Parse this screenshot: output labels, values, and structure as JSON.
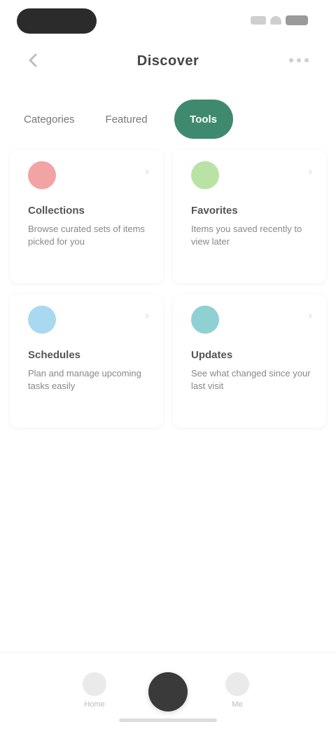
{
  "header": {
    "title": "Discover"
  },
  "tabs": [
    {
      "label": "Categories",
      "active": false
    },
    {
      "label": "Featured",
      "active": false
    },
    {
      "label": "Tools",
      "active": true
    }
  ],
  "cards": [
    {
      "title": "Collections",
      "desc": "Browse curated sets of items picked for you",
      "icon_color": "#f2a3a3",
      "icon": "heart-icon"
    },
    {
      "title": "Favorites",
      "desc": "Items you saved recently to view later",
      "icon_color": "#b9e3a4",
      "icon": "star-icon"
    },
    {
      "title": "Schedules",
      "desc": "Plan and manage upcoming tasks easily",
      "icon_color": "#a9d8f1",
      "icon": "calendar-icon"
    },
    {
      "title": "Updates",
      "desc": "See what changed since your last visit",
      "icon_color": "#8fd0d3",
      "icon": "bell-icon"
    }
  ],
  "nav": {
    "home": "Home",
    "center": "",
    "profile": "Me"
  },
  "colors": {
    "accent": "#3f8a6e"
  }
}
